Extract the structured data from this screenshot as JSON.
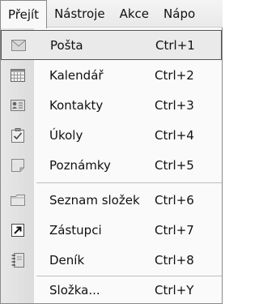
{
  "menubar": {
    "items": [
      {
        "label": "Přejít",
        "active": true
      },
      {
        "label": "Nástroje"
      },
      {
        "label": "Akce"
      },
      {
        "label": "Nápo"
      }
    ]
  },
  "menu": {
    "items": [
      {
        "label": "Pošta",
        "shortcut": "Ctrl+1",
        "icon": "mail-icon",
        "hover": true
      },
      {
        "label": "Kalendář",
        "shortcut": "Ctrl+2",
        "icon": "calendar-icon"
      },
      {
        "label": "Kontakty",
        "shortcut": "Ctrl+3",
        "icon": "contacts-icon"
      },
      {
        "label": "Úkoly",
        "shortcut": "Ctrl+4",
        "icon": "tasks-icon"
      },
      {
        "label": "Poznámky",
        "shortcut": "Ctrl+5",
        "icon": "notes-icon"
      },
      {
        "label": "Seznam složek",
        "shortcut": "Ctrl+6",
        "icon": "folder-list-icon"
      },
      {
        "label": "Zástupci",
        "shortcut": "Ctrl+7",
        "icon": "shortcuts-icon"
      },
      {
        "label": "Deník",
        "shortcut": "Ctrl+8",
        "icon": "journal-icon"
      },
      {
        "label": "Složka...",
        "shortcut": "Ctrl+Y"
      }
    ]
  },
  "colors": {
    "hover_border": "#555555",
    "hover_fill": "#eaeaea",
    "gutter": "#e0e0e0"
  }
}
